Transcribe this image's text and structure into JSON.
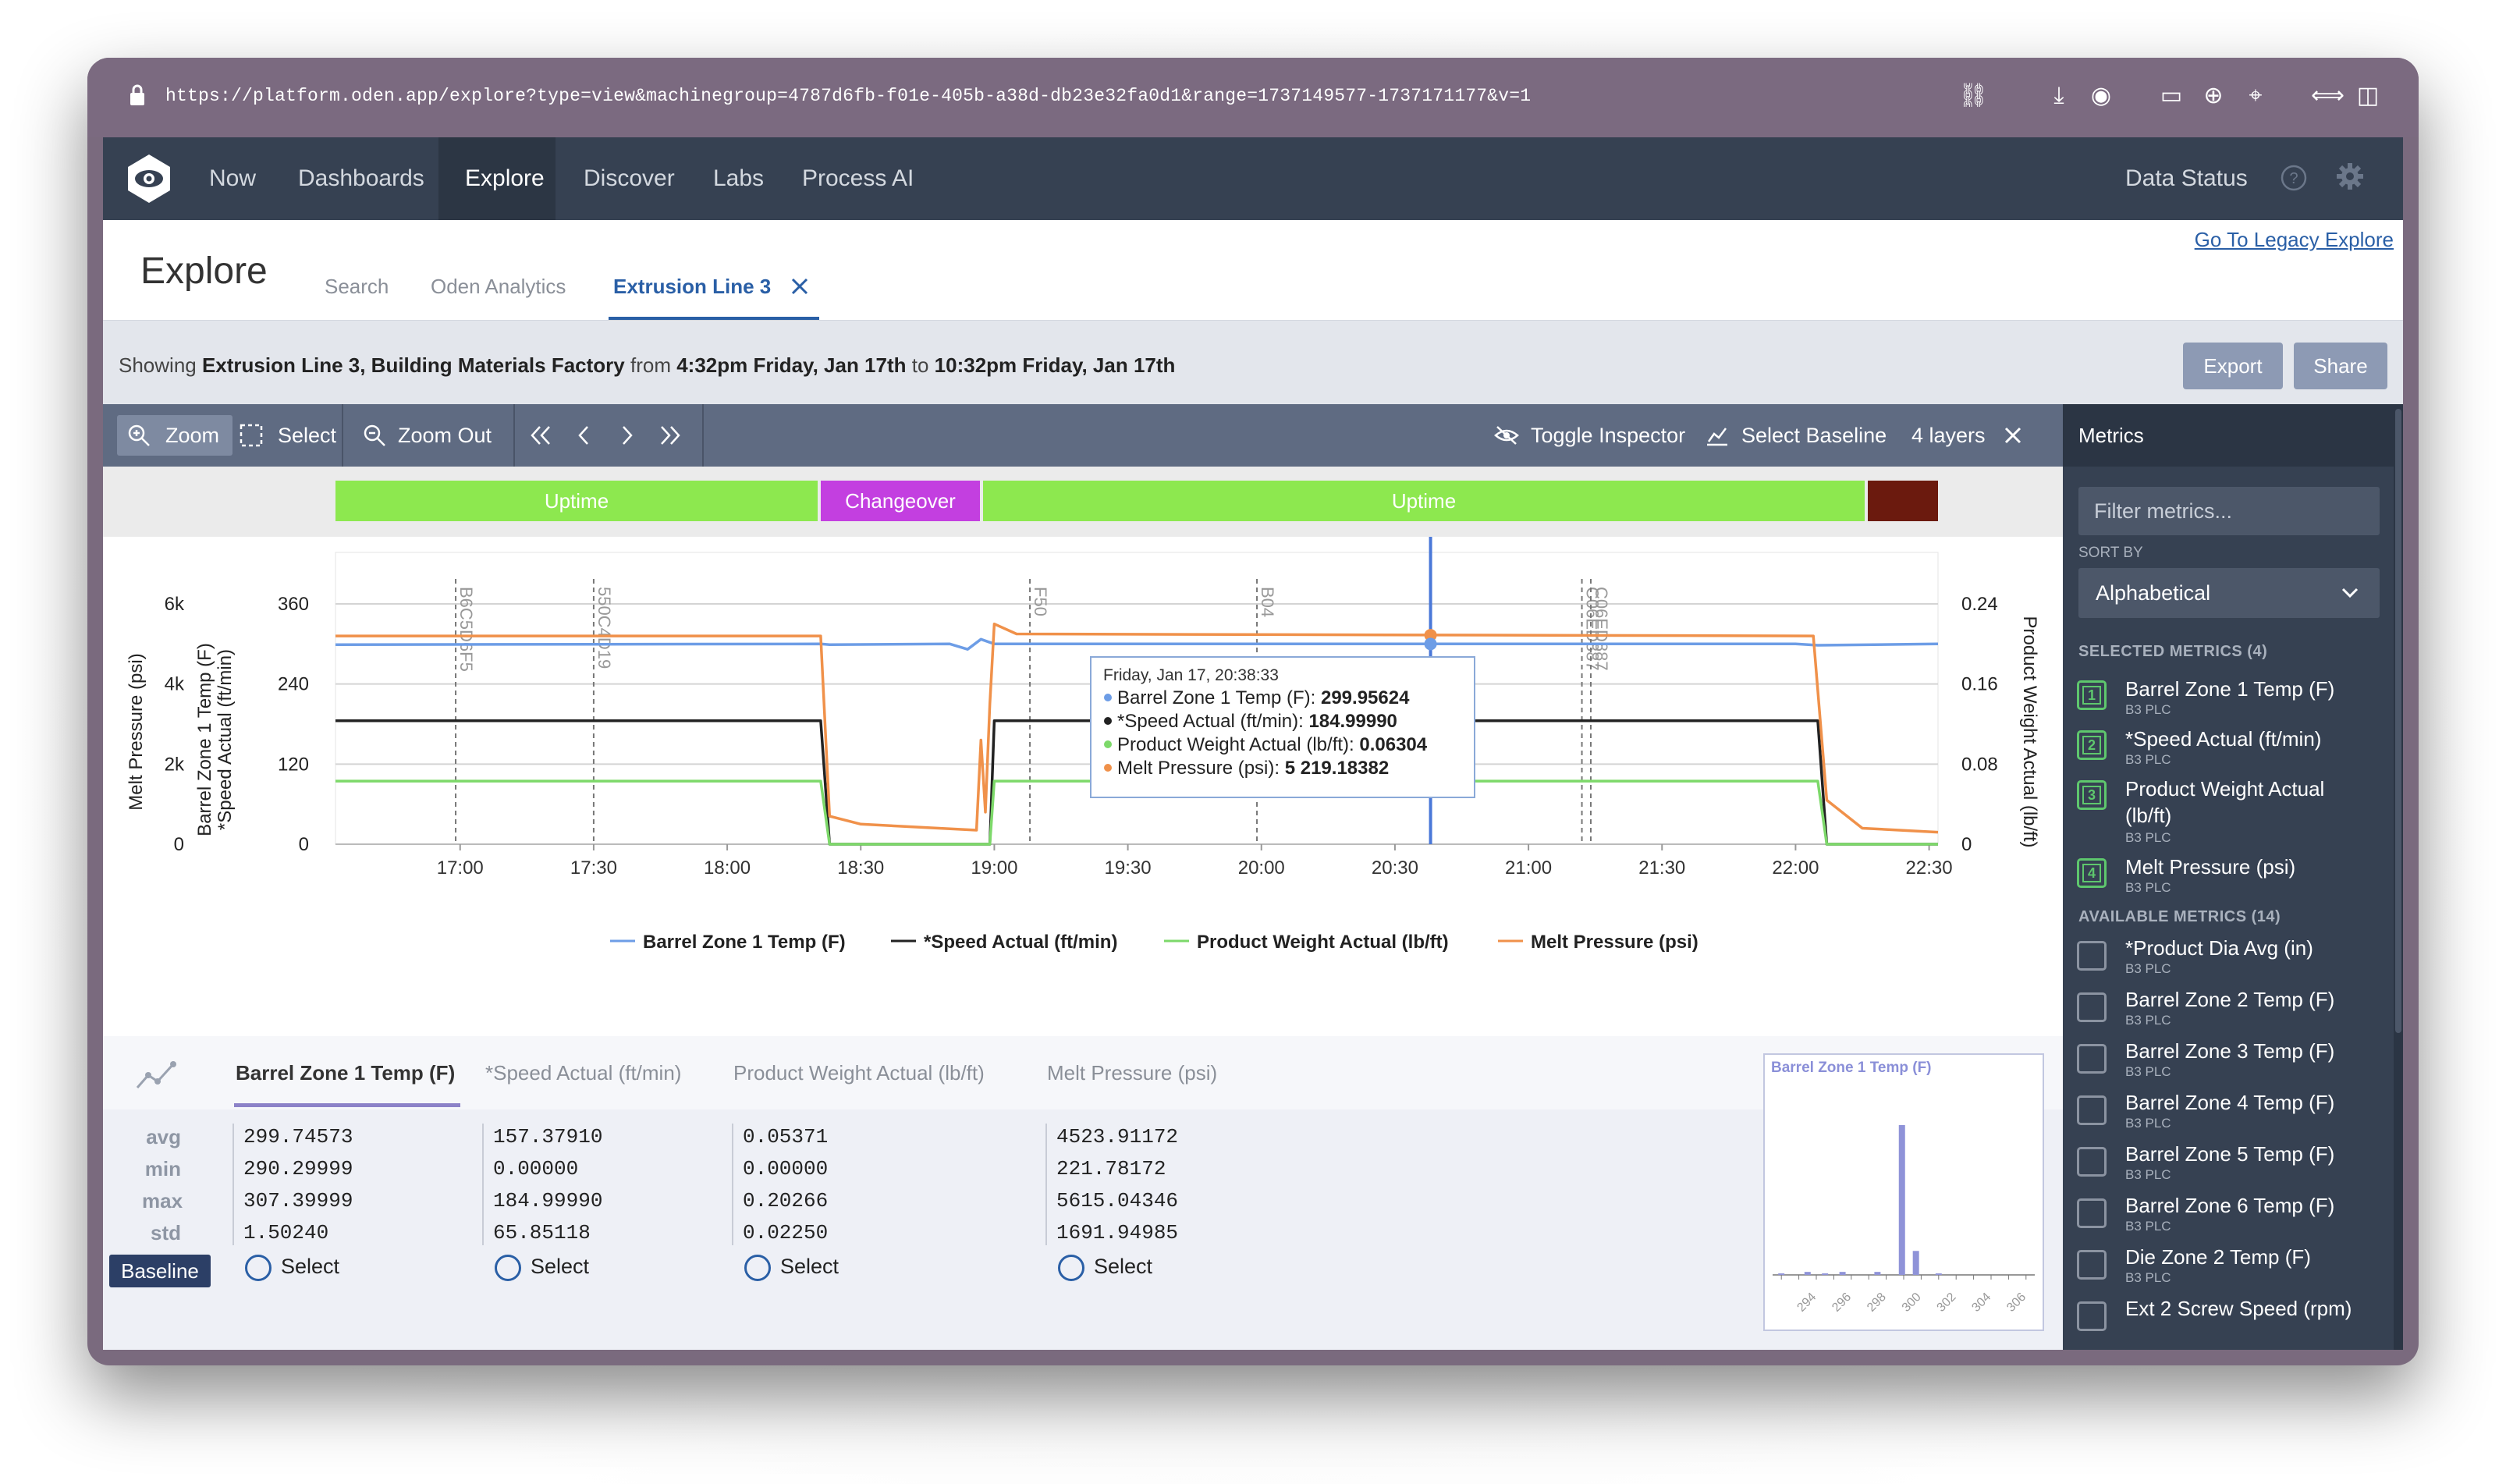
{
  "browser": {
    "url": "https://platform.oden.app/explore?type=view&machinegroup=4787d6fb-f01e-405b-a38d-db23e32fa0d1&range=1737149577-1737171177&v=1"
  },
  "nav": {
    "items": [
      "Now",
      "Dashboards",
      "Explore",
      "Discover",
      "Labs",
      "Process AI"
    ],
    "active": "Explore",
    "data_status": "Data Status"
  },
  "header": {
    "title": "Explore",
    "tabs": [
      "Search",
      "Oden Analytics",
      "Extrusion Line 3"
    ],
    "active_tab": "Extrusion Line 3",
    "legacy_link": "Go To Legacy Explore"
  },
  "showing": {
    "prefix": "Showing",
    "group": "Extrusion Line 3, Building Materials Factory",
    "from_word": "from",
    "start": "4:32pm Friday, Jan 17th",
    "to_word": "to",
    "end": "10:32pm Friday, Jan 17th",
    "export_label": "Export",
    "share_label": "Share"
  },
  "toolbar": {
    "zoom": "Zoom",
    "select": "Select",
    "zoom_out": "Zoom Out",
    "toggle_inspector": "Toggle Inspector",
    "select_baseline": "Select Baseline",
    "layers": "4 layers"
  },
  "states": [
    {
      "label": "Uptime",
      "color": "#8de84f"
    },
    {
      "label": "Changeover",
      "color": "#c33fe0"
    },
    {
      "label": "Uptime",
      "color": "#8de84f"
    },
    {
      "label": "",
      "color": "#6b1a0e"
    }
  ],
  "chart_data": {
    "type": "line",
    "x_ticks": [
      "17:00",
      "17:30",
      "18:00",
      "18:30",
      "19:00",
      "19:30",
      "20:00",
      "20:30",
      "21:00",
      "21:30",
      "22:00",
      "22:30"
    ],
    "axes": {
      "left_outer": {
        "label": "Melt Pressure (psi)",
        "ticks": [
          "0",
          "2k",
          "4k",
          "6k"
        ],
        "range": [
          0,
          6000
        ]
      },
      "left_inner": {
        "label": "Barrel Zone 1 Temp (F)\n*Speed Actual (ft/min)",
        "label_line1": "Barrel Zone 1 Temp (F)",
        "label_line2": "*Speed Actual (ft/min)",
        "ticks": [
          "0",
          "120",
          "240",
          "360"
        ],
        "range": [
          0,
          360
        ]
      },
      "right": {
        "label": "Product Weight Actual (lb/ft)",
        "ticks": [
          "0",
          "0.08",
          "0.16",
          "0.24"
        ],
        "range": [
          0,
          0.24
        ]
      }
    },
    "x_range": [
      "16:32",
      "22:32"
    ],
    "series": [
      {
        "name": "Barrel Zone 1 Temp (F)",
        "color": "#6d9de6",
        "axis": "left_inner",
        "points": [
          [
            "16:32",
            299
          ],
          [
            "18:21",
            300
          ],
          [
            "18:23",
            299
          ],
          [
            "18:50",
            300
          ],
          [
            "18:54",
            292
          ],
          [
            "18:57",
            307
          ],
          [
            "19:00",
            300
          ],
          [
            "22:00",
            300
          ],
          [
            "22:05",
            298
          ],
          [
            "22:32",
            300
          ]
        ]
      },
      {
        "name": "*Speed Actual (ft/min)",
        "color": "#222222",
        "axis": "left_inner",
        "points": [
          [
            "16:32",
            185
          ],
          [
            "18:21",
            185
          ],
          [
            "18:23",
            0
          ],
          [
            "18:59",
            0
          ],
          [
            "19:00",
            185
          ],
          [
            "22:05",
            185
          ],
          [
            "22:07",
            0
          ],
          [
            "22:32",
            0
          ]
        ]
      },
      {
        "name": "Product Weight Actual (lb/ft)",
        "color": "#7dd96a",
        "axis": "right",
        "points": [
          [
            "16:32",
            0.063
          ],
          [
            "18:21",
            0.063
          ],
          [
            "18:23",
            0
          ],
          [
            "18:59",
            0
          ],
          [
            "19:00",
            0.063
          ],
          [
            "22:05",
            0.063
          ],
          [
            "22:07",
            0
          ],
          [
            "22:32",
            0
          ]
        ]
      },
      {
        "name": "Melt Pressure (psi)",
        "color": "#f0914a",
        "axis": "left_outer",
        "points": [
          [
            "16:32",
            5200
          ],
          [
            "18:21",
            5200
          ],
          [
            "18:23",
            700
          ],
          [
            "18:30",
            500
          ],
          [
            "18:56",
            350
          ],
          [
            "18:57",
            2600
          ],
          [
            "18:58",
            800
          ],
          [
            "18:59",
            3500
          ],
          [
            "19:00",
            5500
          ],
          [
            "19:05",
            5250
          ],
          [
            "22:04",
            5200
          ],
          [
            "22:07",
            1100
          ],
          [
            "22:15",
            400
          ],
          [
            "22:32",
            300
          ]
        ]
      }
    ],
    "markers": [
      {
        "time": "16:59",
        "label": "B6C5D6F5"
      },
      {
        "time": "17:30",
        "label": "550C4D19"
      },
      {
        "time": "19:08",
        "label": "F50"
      },
      {
        "time": "19:59",
        "label": "B04"
      },
      {
        "time": "21:12",
        "label": "C06ED887"
      },
      {
        "time": "21:14",
        "label": "C06ED887"
      }
    ],
    "cursor_time": "20:38",
    "tooltip": {
      "time": "Friday, Jan 17, 20:38:33",
      "rows": [
        {
          "name": "Barrel Zone 1 Temp (F)",
          "value": "299.95624"
        },
        {
          "name": "*Speed Actual (ft/min)",
          "value": "184.99990"
        },
        {
          "name": "Product Weight Actual (lb/ft)",
          "value": "0.06304"
        },
        {
          "name": "Melt Pressure (psi)",
          "value": "5 219.18382"
        }
      ]
    }
  },
  "stats": {
    "tabs": [
      "Barrel Zone 1 Temp (F)",
      "*Speed Actual (ft/min)",
      "Product Weight Actual (lb/ft)",
      "Melt Pressure (psi)"
    ],
    "labels": [
      "avg",
      "min",
      "max",
      "std"
    ],
    "columns": [
      [
        "299.74573",
        "290.29999",
        "307.39999",
        "1.50240"
      ],
      [
        "157.37910",
        "0.00000",
        "184.99990",
        "65.85118"
      ],
      [
        "0.05371",
        "0.00000",
        "0.20266",
        "0.02250"
      ],
      [
        "4523.91172",
        "221.78172",
        "5615.04346",
        "1691.94985"
      ]
    ],
    "baseline_label": "Baseline",
    "select_label": "Select"
  },
  "histogram": {
    "title": "Barrel Zone 1 Temp (F)",
    "x_ticks": [
      "294",
      "296",
      "298",
      "300",
      "302",
      "304",
      "306"
    ],
    "bins": [
      {
        "x": 293.0,
        "count": 1
      },
      {
        "x": 294.5,
        "count": 2
      },
      {
        "x": 295.5,
        "count": 1
      },
      {
        "x": 296.5,
        "count": 2
      },
      {
        "x": 298.5,
        "count": 2
      },
      {
        "x": 299.9,
        "count": 100
      },
      {
        "x": 300.7,
        "count": 16
      },
      {
        "x": 302.0,
        "count": 1
      }
    ]
  },
  "metrics": {
    "header": "Metrics",
    "filter_placeholder": "Filter metrics...",
    "sort_by_label": "SORT BY",
    "sort_value": "Alphabetical",
    "selected_header": "SELECTED METRICS (4)",
    "selected": [
      {
        "n": "1",
        "name": "Barrel Zone 1 Temp (F)",
        "source": "B3 PLC"
      },
      {
        "n": "2",
        "name": "*Speed Actual (ft/min)",
        "source": "B3 PLC"
      },
      {
        "n": "3",
        "name": "Product Weight Actual (lb/ft)",
        "source": "B3 PLC"
      },
      {
        "n": "4",
        "name": "Melt Pressure (psi)",
        "source": "B3 PLC"
      }
    ],
    "available_header": "AVAILABLE METRICS (14)",
    "available": [
      {
        "name": "*Product Dia Avg (in)",
        "source": "B3 PLC"
      },
      {
        "name": "Barrel Zone 2 Temp (F)",
        "source": "B3 PLC"
      },
      {
        "name": "Barrel Zone 3 Temp (F)",
        "source": "B3 PLC"
      },
      {
        "name": "Barrel Zone 4 Temp (F)",
        "source": "B3 PLC"
      },
      {
        "name": "Barrel Zone 5 Temp (F)",
        "source": "B3 PLC"
      },
      {
        "name": "Barrel Zone 6 Temp (F)",
        "source": "B3 PLC"
      },
      {
        "name": "Die Zone 2 Temp (F)",
        "source": "B3 PLC"
      },
      {
        "name": "Ext 2 Screw Speed (rpm)",
        "source": ""
      }
    ]
  }
}
